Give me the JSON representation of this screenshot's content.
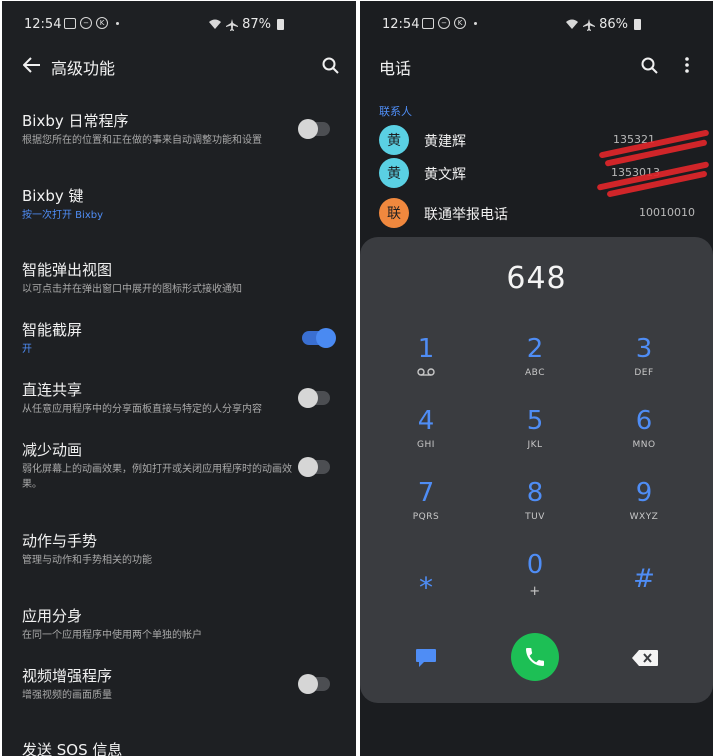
{
  "left": {
    "status": {
      "time": "12:54",
      "battery": "87%"
    },
    "title": "高级功能",
    "settings": [
      {
        "title": "Bixby 日常程序",
        "sub": "根据您所在的位置和正在做的事来自动调整功能和设置",
        "toggle": "off"
      },
      {
        "title": "Bixby 键",
        "sub": "按一次打开 Bixby",
        "toggle": "none"
      },
      {
        "title": "智能弹出视图",
        "sub": "以可点击并在弹出窗口中展开的图标形式接收通知",
        "toggle": "none"
      },
      {
        "title": "智能截屏",
        "sub": "开",
        "toggle": "on"
      },
      {
        "title": "直连共享",
        "sub": "从任意应用程序中的分享面板直接与特定的人分享内容",
        "toggle": "off"
      },
      {
        "title": "减少动画",
        "sub": "弱化屏幕上的动画效果，例如打开或关闭应用程序时的动画效果。",
        "toggle": "off"
      },
      {
        "title": "动作与手势",
        "sub": "管理与动作和手势相关的功能",
        "toggle": "none"
      },
      {
        "title": "应用分身",
        "sub": "在同一个应用程序中使用两个单独的帐户",
        "toggle": "none"
      },
      {
        "title": "视频增强程序",
        "sub": "增强视频的画面质量",
        "toggle": "off"
      },
      {
        "title": "发送 SOS 信息",
        "sub": "",
        "toggle": "none"
      }
    ]
  },
  "right": {
    "status": {
      "time": "12:54",
      "battery": "86%"
    },
    "title": "电话",
    "section": "联系人",
    "contacts": [
      {
        "avatar": "黄",
        "name": "黄建辉",
        "number": "135321",
        "color": "#5ad0e3"
      },
      {
        "avatar": "黄",
        "name": "黄文辉",
        "number": "1353013",
        "color": "#5ad0e3"
      },
      {
        "avatar": "联",
        "name": "联通举报电话",
        "number": "10010010",
        "color": "#f0883e"
      }
    ],
    "dialed": "648",
    "keys": [
      {
        "digit": "1",
        "letters": ""
      },
      {
        "digit": "2",
        "letters": "ABC"
      },
      {
        "digit": "3",
        "letters": "DEF"
      },
      {
        "digit": "4",
        "letters": "GHI"
      },
      {
        "digit": "5",
        "letters": "JKL"
      },
      {
        "digit": "6",
        "letters": "MNO"
      },
      {
        "digit": "7",
        "letters": "PQRS"
      },
      {
        "digit": "8",
        "letters": "TUV"
      },
      {
        "digit": "9",
        "letters": "WXYZ"
      },
      {
        "digit": "⁎",
        "letters": ""
      },
      {
        "digit": "0",
        "letters": "+"
      },
      {
        "digit": "#",
        "letters": ""
      }
    ]
  },
  "colors": {
    "accent": "#4f8df5",
    "call": "#1dbf55",
    "background": "#1e2023",
    "dialpad": "#3a3c40"
  }
}
